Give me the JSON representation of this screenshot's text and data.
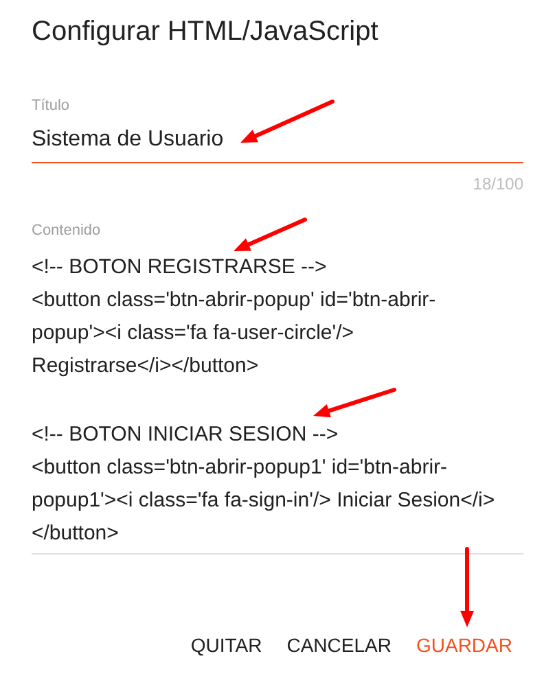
{
  "dialog": {
    "title": "Configurar HTML/JavaScript"
  },
  "title_field": {
    "label": "Título",
    "value": "Sistema de Usuario",
    "counter": "18/100",
    "focused": true
  },
  "content_field": {
    "label": "Contenido",
    "blocks": [
      [
        "<!-- BOTON REGISTRARSE -->",
        "<button class='btn-abrir-popup' id='btn-abrir-",
        "popup'><i class='fa fa-user-circle'/>",
        "Registrarse</i></button>"
      ],
      [
        "<!-- BOTON INICIAR SESION -->",
        "<button class='btn-abrir-popup1' id='btn-abrir-",
        "popup1'><i class='fa fa-sign-in'/> Iniciar Sesion</i>",
        "</button>"
      ]
    ]
  },
  "buttons": [
    {
      "label": "QUITAR",
      "primary": false
    },
    {
      "label": "CANCELAR",
      "primary": false
    },
    {
      "label": "GUARDAR",
      "primary": true
    }
  ]
}
